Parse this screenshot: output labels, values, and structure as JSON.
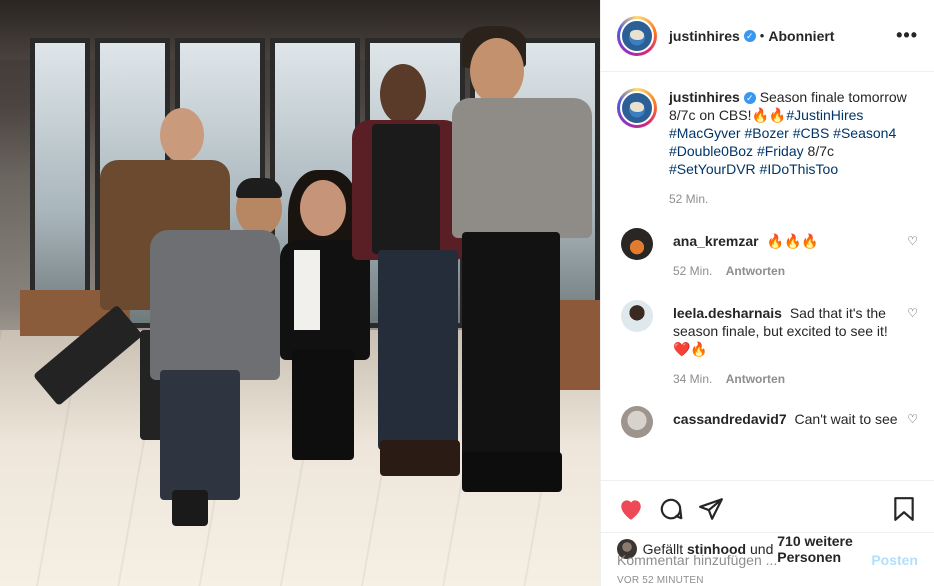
{
  "photo": {
    "alt": "Five people posing on a TV set"
  },
  "header": {
    "username": "justinhires",
    "verified_icon": "verified-badge-icon",
    "separator": "•",
    "follow_status": "Abonniert",
    "more_icon": "more-options-icon",
    "more_label": "•••"
  },
  "caption": {
    "username": "justinhires",
    "text_before": "Season finale tomorrow 8/7c on CBS!",
    "emoji": "🔥🔥",
    "hashtags": "#JustinHires #MacGyver #Bozer #CBS #Season4 #Double0Boz #Friday",
    "text_middle": " 8/7c ",
    "hashtags2": "#SetYourDVR #IDoThisToo",
    "time": "52 Min."
  },
  "comments": [
    {
      "username": "ana_kremzar",
      "text": "🔥🔥🔥",
      "time": "52 Min.",
      "reply_label": "Antworten"
    },
    {
      "username": "leela.desharnais",
      "text": "Sad that it's the season finale, but excited to see it! ❤️🔥",
      "time": "34 Min.",
      "reply_label": "Antworten"
    },
    {
      "username": "cassandredavid7",
      "text": "Can't wait to see"
    }
  ],
  "actions": {
    "like_icon": "heart-filled-icon",
    "comment_icon": "comment-icon",
    "share_icon": "share-icon",
    "save_icon": "bookmark-icon",
    "like_color": "#ed4956"
  },
  "likes": {
    "prefix": "Gefällt",
    "user": "stinhood",
    "middle": "und",
    "others": "710 weitere Personen"
  },
  "post_time": "VOR 52 MINUTEN",
  "add_comment": {
    "placeholder": "Kommentar hinzufügen ...",
    "post_label": "Posten"
  }
}
